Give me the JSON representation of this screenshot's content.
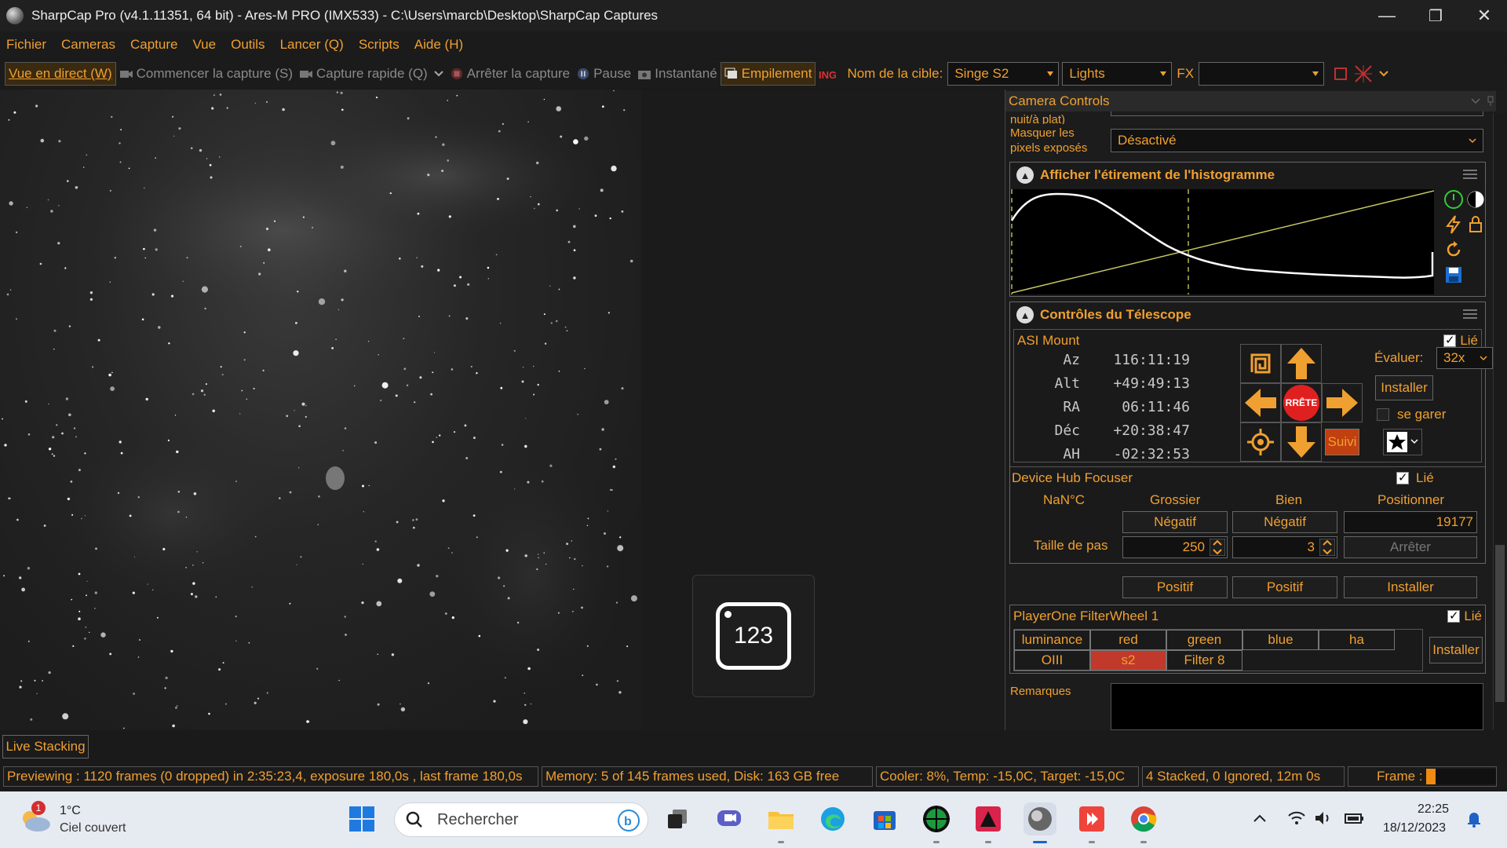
{
  "window": {
    "title": "SharpCap Pro (v4.1.11351, 64 bit) - Ares-M PRO (IMX533) - C:\\Users\\marcb\\Desktop\\SharpCap Captures",
    "minimize": "—",
    "restore": "❐",
    "close": "✕"
  },
  "menu": [
    {
      "label": "Fichier"
    },
    {
      "label": "Cameras"
    },
    {
      "label": "Capture"
    },
    {
      "label": "Vue"
    },
    {
      "label": "Outils"
    },
    {
      "label": "Lancer (Q)"
    },
    {
      "label": "Scripts"
    },
    {
      "label": "Aide (H)"
    }
  ],
  "toolbar": {
    "live_view": "Vue en direct (W)",
    "start_capture": "Commencer la capture (S)",
    "quick_capture": "Capture rapide (Q)",
    "stop_capture": "Arrêter la capture",
    "pause": "Pause",
    "snapshot": "Instantané",
    "stacking": "Empilement",
    "target_label": "Nom de la cible:",
    "target_value": "Singe S2",
    "frame_type": "Lights",
    "fx_label": "FX",
    "fx_value": ""
  },
  "panel": {
    "title": "Camera Controls",
    "cut_row": "nuit/à plat)",
    "mask_label": "Masquer les pixels exposés",
    "mask_value": "Désactivé",
    "histogram": {
      "title": "Afficher l'étirement de l'histogramme"
    },
    "telescope": {
      "title": "Contrôles du Télescope",
      "mount_name": "ASI Mount",
      "linked": "Lié",
      "coords": [
        {
          "label": "Az",
          "value": "116:11:19"
        },
        {
          "label": "Alt",
          "value": "+49:49:13"
        },
        {
          "label": "RA",
          "value": "06:11:46"
        },
        {
          "label": "Déc",
          "value": "+20:38:47"
        },
        {
          "label": "AH",
          "value": "-02:32:53"
        }
      ],
      "stop": "RRÊTE",
      "rate_label": "Évaluer:",
      "rate_value": "32x",
      "install": "Installer",
      "park": "se garer",
      "tracking": "Suivi"
    },
    "focuser": {
      "name": "Device Hub Focuser",
      "linked": "Lié",
      "temp": "NaN°C",
      "col_coarse": "Grossier",
      "col_fine": "Bien",
      "col_position": "Positionner",
      "negative": "Négatif",
      "positive": "Positif",
      "step_label": "Taille de pas",
      "coarse_step": "250",
      "fine_step": "3",
      "position": "19177",
      "stop": "Arrêter",
      "install": "Installer"
    },
    "filterwheel": {
      "name": "PlayerOne FilterWheel 1",
      "linked": "Lié",
      "filters_row1": [
        "luminance",
        "red",
        "green",
        "blue",
        "ha"
      ],
      "filters_row2": [
        "OIII",
        "s2",
        "Filter 8"
      ],
      "selected": "s2",
      "install": "Installer"
    },
    "notes_label": "Remarques"
  },
  "keyboard_overlay": "123",
  "live_stacking_tab": "Live Stacking",
  "status": {
    "preview": "Previewing : 1120 frames (0 dropped) in 2:35:23,4, exposure 180,0s , last frame 180,0s",
    "memory": "Memory: 5 of 145 frames used, Disk: 163 GB free",
    "cooler": "Cooler: 8%, Temp: -15,0C, Target: -15,0C",
    "stacked": "4 Stacked, 0 Ignored, 12m 0s",
    "frame_label": "Frame :",
    "frame_progress": 0.12
  },
  "taskbar": {
    "weather_temp": "1°C",
    "weather_desc": "Ciel couvert",
    "weather_badge": "1",
    "search_placeholder": "Rechercher",
    "time": "22:25",
    "date": "18/12/2023"
  },
  "colors": {
    "accent": "#f0a030",
    "selected_filter": "#c0392b",
    "stop_button": "#e02020"
  }
}
